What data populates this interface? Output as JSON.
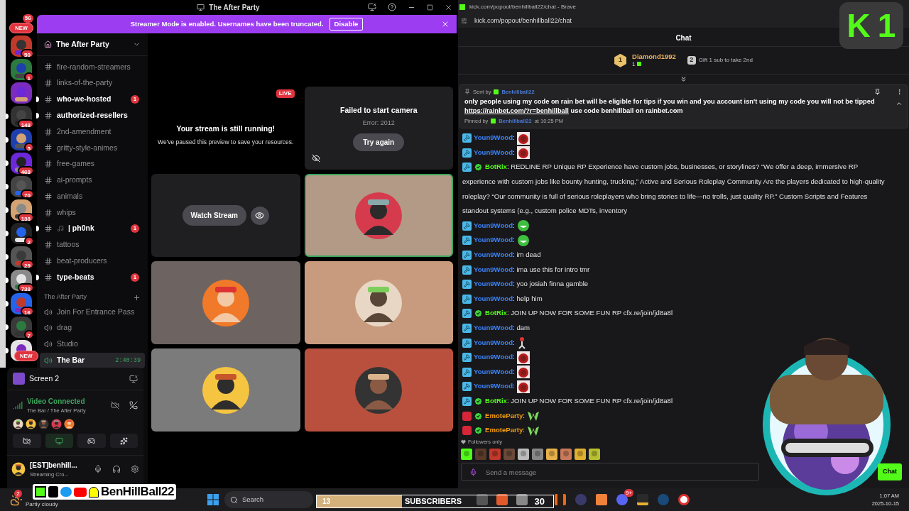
{
  "discord": {
    "title": "The After Party",
    "banner": {
      "text": "Streamer Mode is enabled. Usernames have been truncated.",
      "button": "Disable"
    },
    "rail": {
      "top_pill": {
        "label": "NEW",
        "badge": "56"
      },
      "bottom_pill": {
        "label": "NEW"
      },
      "servers": [
        {
          "badge": "50",
          "unread": false
        },
        {
          "badge": "1",
          "unread": false
        },
        {
          "unread": false
        },
        {
          "badge": "148",
          "unread": true
        },
        {
          "badge": "5",
          "unread": true
        },
        {
          "badge": "468",
          "unread": true
        },
        {
          "badge": "70",
          "unread": true
        },
        {
          "badge": "138",
          "unread": true
        },
        {
          "badge": "2",
          "unread": true
        },
        {
          "badge": "29",
          "unread": true
        },
        {
          "badge": "738",
          "unread": true
        },
        {
          "badge": "16",
          "unread": true
        },
        {
          "badge": "7",
          "unread": true
        },
        {
          "unread": true
        }
      ]
    },
    "server_name": "The After Party",
    "channels": [
      {
        "name": "fire-random-streamers",
        "kind": "text",
        "unread": false
      },
      {
        "name": "links-of-the-party",
        "kind": "text",
        "unread": false
      },
      {
        "name": "who-we-hosted",
        "kind": "text",
        "unread": true,
        "mentions": "1"
      },
      {
        "name": "authorized-resellers",
        "kind": "text",
        "unread": true
      },
      {
        "name": "2nd-amendment",
        "kind": "text",
        "unread": false
      },
      {
        "name": "gritty-style-animes",
        "kind": "text",
        "unread": false
      },
      {
        "name": "free-games",
        "kind": "text",
        "unread": false
      },
      {
        "name": "ai-prompts",
        "kind": "text",
        "unread": false
      },
      {
        "name": "animals",
        "kind": "text",
        "unread": false
      },
      {
        "name": "whips",
        "kind": "text",
        "unread": false
      },
      {
        "name": "| ph0nk",
        "kind": "music",
        "unread": true,
        "mentions": "1"
      },
      {
        "name": "tattoos",
        "kind": "text",
        "unread": false
      },
      {
        "name": "beat-producers",
        "kind": "text",
        "unread": false
      },
      {
        "name": "type-beats",
        "kind": "text",
        "unread": true,
        "mentions": "1"
      }
    ],
    "category": "The After Party",
    "voice_channels": [
      {
        "name": "Join For Entrance Pass",
        "selected": false
      },
      {
        "name": "drag",
        "selected": false
      },
      {
        "name": "Studio",
        "selected": false
      },
      {
        "name": "The Bar",
        "selected": true,
        "time": "2:40:39"
      }
    ],
    "panel": {
      "stream": "Screen 2",
      "status": "Video Connected",
      "location": "The Bar / The After Party",
      "user": "[EST]benhill...",
      "activity": "Streaming Cro..."
    },
    "tiles": [
      {
        "kind": "paused",
        "badge": "LIVE",
        "title": "Your stream is still running!",
        "subtitle": "We've paused this preview to save your resources."
      },
      {
        "kind": "error",
        "title": "Failed to start camera",
        "subtitle": "Error: 2012",
        "button": "Try again"
      },
      {
        "kind": "watch",
        "button": "Watch Stream"
      },
      {
        "kind": "avatar",
        "color": "#b39a86",
        "speaking": true
      },
      {
        "kind": "avatar",
        "color": "#6d6462",
        "speaking": false
      },
      {
        "kind": "avatar",
        "color": "#c89b7e",
        "speaking": false
      },
      {
        "kind": "avatar",
        "color": "#7b7b7b",
        "speaking": false
      },
      {
        "kind": "avatar",
        "color": "#b9503d",
        "speaking": false
      }
    ]
  },
  "browser": {
    "title": "kick.com/popout/benhillball22/chat - Brave",
    "url": "kick.com/popout/benhillball22/chat"
  },
  "chat": {
    "title": "Chat",
    "leader": {
      "rank": "1",
      "name": "Diamond1992",
      "count": "1"
    },
    "next": {
      "rank": "2",
      "text": "Gift 1 sub to take 2nd"
    },
    "pinned": {
      "sent_by": "Sent by",
      "author": "Benhillball22",
      "text": "only people using my code on rain bet will be eligible for tips if you win and you account isn't using my code you will not be tipped",
      "link": "https://rainbet.com/?r=benhillball",
      "after_link": "use code benhillball on rainbet.com",
      "pinned_by": "Pinned by",
      "pinner": "Benhillball22",
      "time": "at 10:25 PM",
      "expanded": true
    },
    "messages": [
      {
        "user": "Youn9Wood",
        "kind": "moderator",
        "text": ":",
        "emote": {
          "kind": "redface"
        }
      },
      {
        "user": "Youn9Wood",
        "kind": "moderator",
        "text": ":",
        "emote": {
          "kind": "redface"
        }
      },
      {
        "user": "BotRix",
        "kind": "bot",
        "text": ": REDLINE RP Unique RP Experience have custom jobs, businesses, or storylines? “We offer a deep, immersive RP experience with custom jobs like bounty hunting, trucking,” Active and Serious Roleplay Community Are the players dedicated to high-quality roleplay? “Our community is full of serious roleplayers who bring stories to life—no trolls, just quality RP.” Custom Scripts and Features standout systems (e.g., custom police MDTs, inventory"
      },
      {
        "user": "Youn9Wood",
        "kind": "moderator",
        "text": ":",
        "emote": {
          "kind": "laugh"
        }
      },
      {
        "user": "Youn9Wood",
        "kind": "moderator",
        "text": ":",
        "emote": {
          "kind": "laugh"
        }
      },
      {
        "user": "Youn9Wood",
        "kind": "moderator",
        "text": ": im dead"
      },
      {
        "user": "Youn9Wood",
        "kind": "moderator",
        "text": ": ima use this for intro tmr"
      },
      {
        "user": "Youn9Wood",
        "kind": "moderator",
        "text": ": yoo josiah finna gamble"
      },
      {
        "user": "Youn9Wood",
        "kind": "moderator",
        "text": ": help him"
      },
      {
        "user": "BotRix",
        "kind": "bot",
        "text": ": JOIN UP NOW FOR SOME FUN RP cfx.re/join/jd8a8l"
      },
      {
        "user": "Youn9Wood",
        "kind": "moderator",
        "text": ": dam"
      },
      {
        "user": "Youn9Wood",
        "kind": "moderator",
        "text": ":",
        "emote": {
          "kind": "figure"
        }
      },
      {
        "user": "Youn9Wood",
        "kind": "moderator",
        "text": ":",
        "emote": {
          "kind": "redface"
        }
      },
      {
        "user": "Youn9Wood",
        "kind": "moderator",
        "text": ":",
        "emote": {
          "kind": "redface"
        }
      },
      {
        "user": "Youn9Wood",
        "kind": "moderator",
        "text": ":",
        "emote": {
          "kind": "redface"
        }
      },
      {
        "user": "BotRix",
        "kind": "bot",
        "text": ": JOIN UP NOW FOR SOME FUN RP cfx.re/join/jd8a8l"
      },
      {
        "user": "EmoteParty",
        "kind": "party",
        "text": ":",
        "emote": {
          "kind": "w"
        }
      },
      {
        "user": "EmoteParty",
        "kind": "party",
        "text": ":",
        "emote": {
          "kind": "w"
        }
      }
    ],
    "followers_only": "Followers only",
    "input": {
      "placeholder": "Send a message"
    },
    "send": "Chat"
  },
  "taskbar": {
    "weather": {
      "badge": "2",
      "text": "Partly cloudy"
    },
    "search": {
      "placeholder": "Search"
    },
    "discord_badge": "9+",
    "time": "1:07 AM",
    "date": "2025-10-15"
  },
  "overlays": {
    "logo": {
      "letter": "K",
      "number": "1"
    },
    "social": {
      "handle": "BenHillBall22"
    },
    "subscribers": {
      "current": "13",
      "label": "SUBSCRIBERS",
      "goal": "30"
    }
  }
}
